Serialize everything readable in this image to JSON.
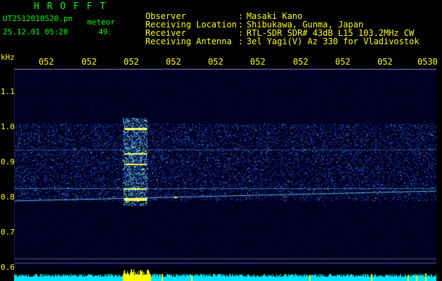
{
  "header": {
    "brand": "HROFFT",
    "filename": "UT2512010520.pn",
    "mode": "meteor",
    "timestamp": "25.12.01 05:20",
    "count": "49."
  },
  "info": [
    {
      "label": "Observer",
      "value": "Masaki Kano"
    },
    {
      "label": "Receiving Location",
      "value": "Shibukawa, Gunma, Japan"
    },
    {
      "label": "Receiver",
      "value": "RTL-SDR SDR# 43dB L15 103.2MHz CW"
    },
    {
      "label": "Receiving Antenna",
      "value": "3el Yagi(V) Az 330 for Vladivostok"
    }
  ],
  "axes": {
    "y_unit": "kHz",
    "x_ticks": [
      "052",
      "052",
      "052",
      "052",
      "052",
      "052",
      "052",
      "052",
      "052",
      "0530"
    ],
    "y_ticks": [
      "1.1",
      "1.0",
      "0.9",
      "0.8",
      "0.7",
      "0.6"
    ]
  },
  "colors": {
    "background": "#000000",
    "plot_background": "#000022",
    "text_green": "#00ff00",
    "text_yellow": "#ffff00",
    "spectrum_cyan": "#00e5ff",
    "spectrum_yellow": "#ffff00",
    "meteor_trail": "#ffff55",
    "noise": "#2a6bff"
  }
}
